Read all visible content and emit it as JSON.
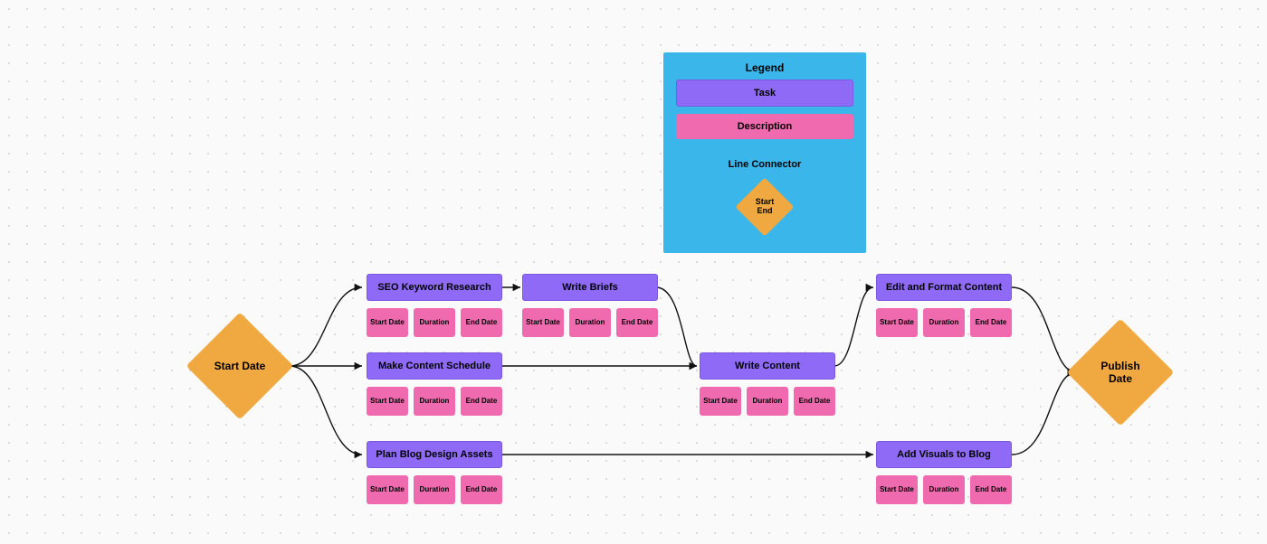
{
  "start": {
    "label": "Start Date"
  },
  "end": {
    "label": "Publish\nDate"
  },
  "chips": {
    "start": "Start\nDate",
    "duration": "Duration",
    "end": "End\nDate"
  },
  "tasks": {
    "seo": {
      "title": "SEO Keyword Research"
    },
    "briefs": {
      "title": "Write Briefs"
    },
    "schedule": {
      "title": "Make Content Schedule"
    },
    "write": {
      "title": "Write Content"
    },
    "plan": {
      "title": "Plan Blog Design Assets"
    },
    "edit": {
      "title": "Edit and Format Content"
    },
    "visuals": {
      "title": "Add Visuals to Blog"
    }
  },
  "legend": {
    "title": "Legend",
    "task": "Task",
    "description": "Description",
    "connector": "Line Connector",
    "startend": "Start\nEnd"
  },
  "colors": {
    "task": "#8e6af6",
    "desc": "#f06aaf",
    "diamond": "#f0a940",
    "legendbg": "#3bb6ea"
  }
}
